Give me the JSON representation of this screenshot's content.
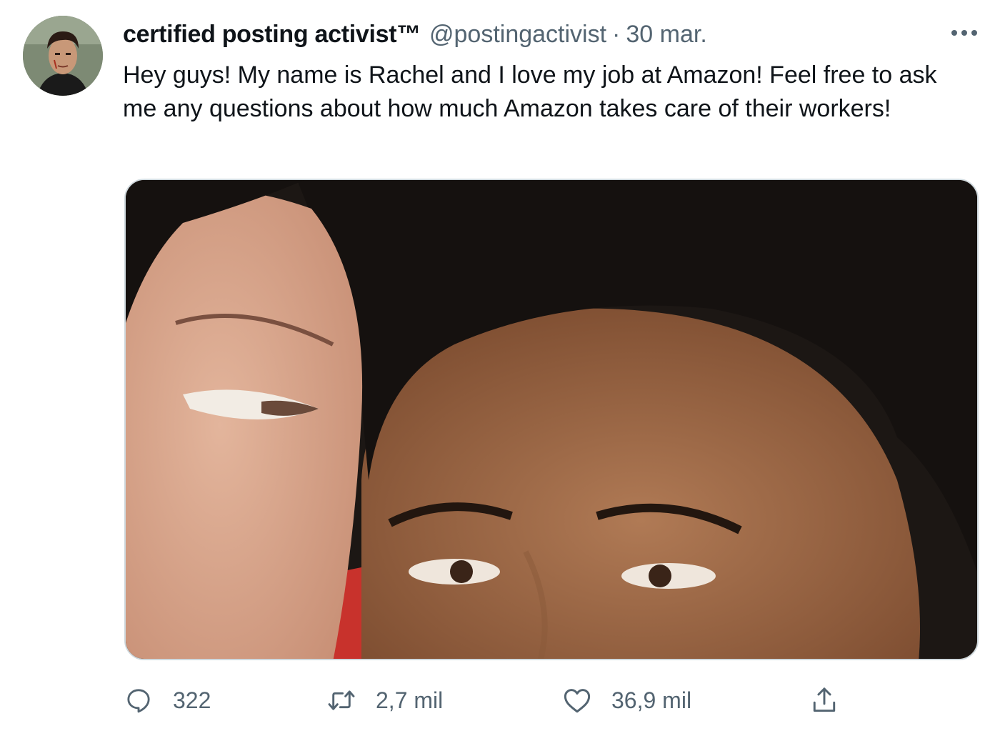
{
  "author": {
    "display_name": "certified posting activist™",
    "handle": "@postingactivist",
    "separator": "·",
    "timestamp": "30 mar."
  },
  "tweet": {
    "text": "Hey guys! My name is Rachel and I love my job at Amazon! Feel free to ask me any questions about how much Amazon takes care of their workers!"
  },
  "actions": {
    "reply_count": "322",
    "retweet_count": "2,7 mil",
    "like_count": "36,9 mil"
  },
  "icons": {
    "more": "more-horizontal-icon",
    "reply": "reply-bubble-icon",
    "retweet": "retweet-icon",
    "like": "heart-icon",
    "share": "share-upload-icon"
  },
  "colors": {
    "text": "#0f1419",
    "secondary": "#536471",
    "border": "#cfd9de"
  }
}
